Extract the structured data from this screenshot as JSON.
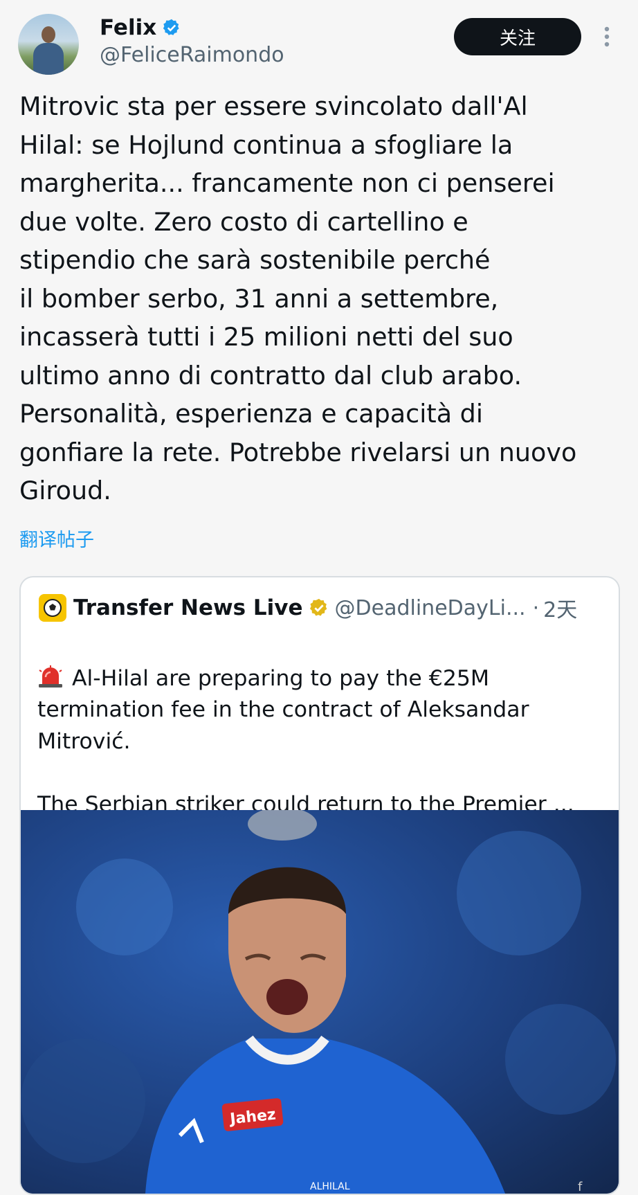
{
  "tweet": {
    "author_name": "Felix",
    "author_handle": "@FeliceRaimondo",
    "follow_label": "关注",
    "text": "Mitrovic sta per essere svincolato dall'Al\nHilal: se Hojlund continua a sfogliare la\nmargherita... francamente non ci penserei\ndue volte. Zero costo di cartellino e\nstipendio che sarà sostenibile perché\nil bomber serbo, 31 anni a settembre,\nincasserà tutti i 25 milioni netti del suo\nultimo anno di contratto dal club arabo.\nPersonalità, esperienza e capacità di\ngonfiare la rete. Potrebbe rivelarsi un nuovo\nGiroud.",
    "translate_label": "翻译帖子"
  },
  "quoted_tweet": {
    "author_name": "Transfer News Live",
    "author_handle": "@DeadlineDayLi...",
    "separator": "·",
    "time": "2天",
    "text": "Al-Hilal are preparing to pay the €25M\ntermination fee in the contract of Aleksandar\nMitrović.\n\nThe Serbian striker could return to the Premier ...",
    "image": {
      "jersey_sponsor": "Jahez",
      "club_crest_text": "ALHILAL"
    }
  },
  "icons": {
    "verified_color": "#1d9bf0",
    "quoted_verified_color": "#e2b719"
  },
  "watermark": "f"
}
